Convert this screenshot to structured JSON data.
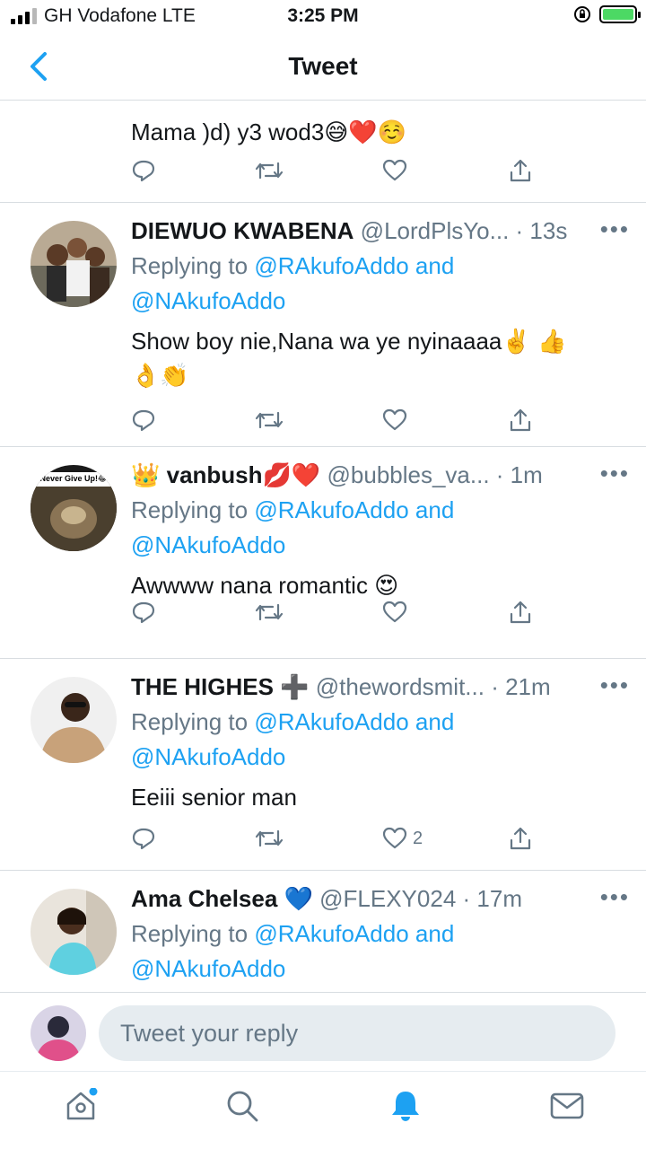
{
  "status": {
    "carrier": "GH Vodafone  LTE",
    "time": "3:25 PM"
  },
  "header": {
    "title": "Tweet"
  },
  "tweets": [
    {
      "body": "Mama )d) y3 wod3😅❤️☺️"
    },
    {
      "name": "DIEWUO KWABENA",
      "handle": "@LordPlsYo...",
      "time": "· 13s",
      "replying_prefix": "Replying to ",
      "replying_users": "@RAkufoAddo and",
      "replying_users_2": "@NAkufoAddo",
      "body": "Show boy nie,Nana wa ye nyinaaaa✌️ 👍 👌👏"
    },
    {
      "name_prefix": "👑",
      "name": "vanbush💋❤️",
      "handle": "@bubbles_va...",
      "time": "· 1m",
      "avatar_caption": "Never Give Up!😂",
      "replying_prefix": "Replying to ",
      "replying_users": "@RAkufoAddo and",
      "replying_users_2": "@NAkufoAddo",
      "body": "Awwww nana romantic 😍"
    },
    {
      "name": "THE HIGHES ➕",
      "handle": "@thewordsmit...",
      "time": "· 21m",
      "replying_prefix": "Replying to ",
      "replying_users": "@RAkufoAddo and",
      "replying_users_2": "@NAkufoAddo",
      "body": "Eeiii senior man",
      "like_count": "2"
    },
    {
      "name": "Ama Chelsea 💙",
      "handle": "@FLEXY024",
      "time": "· 17m",
      "replying_prefix": "Replying to ",
      "replying_users": "@RAkufoAddo and",
      "replying_users_2": "@NAkufoAddo"
    }
  ],
  "reply_bar": {
    "placeholder": "Tweet your reply"
  },
  "tabs": [
    {
      "icon": "home-icon"
    },
    {
      "icon": "search-icon"
    },
    {
      "icon": "notifications-icon",
      "active": true
    },
    {
      "icon": "messages-icon"
    }
  ],
  "colors": {
    "accent": "#1da1f2",
    "text_secondary": "#657786",
    "divider": "#d8dde1"
  }
}
